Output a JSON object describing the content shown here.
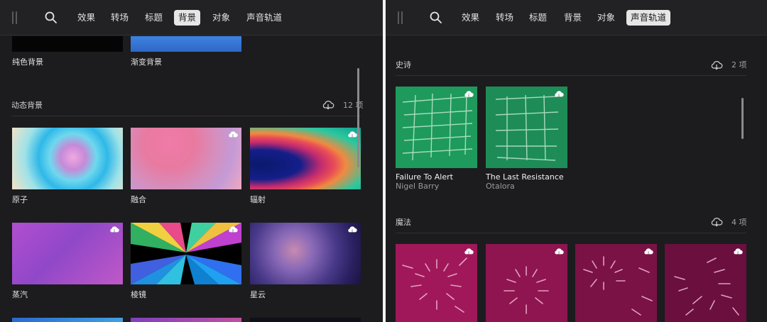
{
  "tabs": {
    "effects": "效果",
    "transitions": "转场",
    "titles": "标题",
    "backgrounds": "背景",
    "objects": "对象",
    "soundtracks": "声音轨道"
  },
  "left": {
    "active_tab": "背景",
    "top_row": [
      {
        "label": "纯色背景",
        "color": "#050505"
      },
      {
        "label": "渐变背景",
        "color": "#3a78d8"
      }
    ],
    "dynamic_section": {
      "title": "动态背景",
      "count": "12 项",
      "items": [
        {
          "label": "原子"
        },
        {
          "label": "融合"
        },
        {
          "label": "辐射"
        },
        {
          "label": "蒸汽"
        },
        {
          "label": "棱镜"
        },
        {
          "label": "星云"
        }
      ]
    }
  },
  "right": {
    "active_tab": "声音轨道",
    "epic_section": {
      "title": "史诗",
      "count": "2 项",
      "color": "#1e9a5c",
      "tracks": [
        {
          "title": "Failure To Alert",
          "artist": "Nigel Barry"
        },
        {
          "title": "The Last Resistance",
          "artist": "Otalora"
        }
      ]
    },
    "magic_section": {
      "title": "魔法",
      "count": "4 项",
      "colors": [
        "#a0185a",
        "#8e1550",
        "#7a1246",
        "#6a0f3e"
      ]
    }
  }
}
